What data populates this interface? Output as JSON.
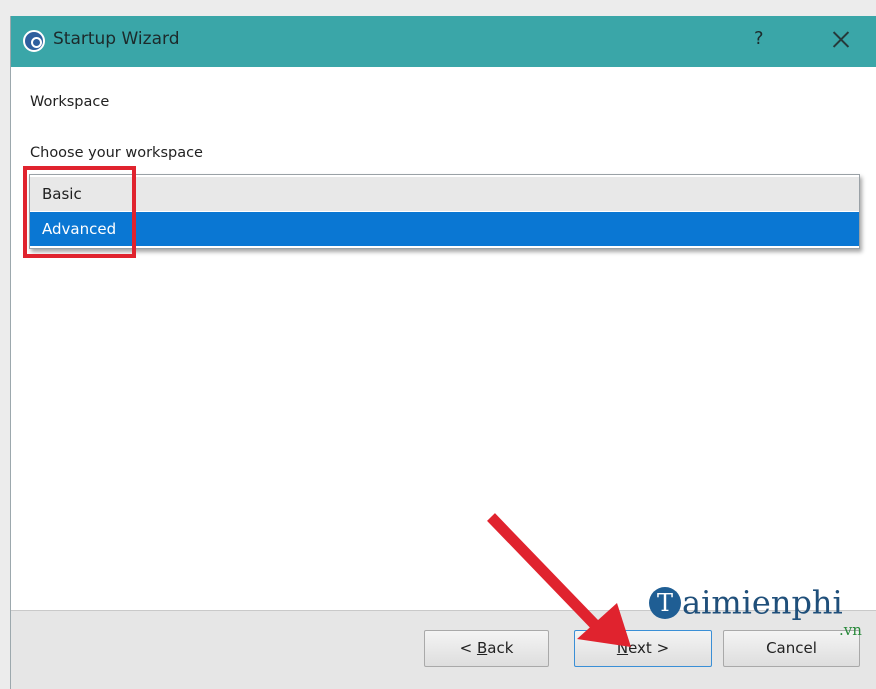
{
  "window": {
    "title": "Startup Wizard",
    "help_label": "?"
  },
  "page": {
    "section_title": "Workspace",
    "prompt": "Choose your workspace"
  },
  "dropdown": {
    "options": [
      {
        "label": "Basic",
        "selected": false
      },
      {
        "label": "Advanced",
        "selected": true
      }
    ]
  },
  "buttons": {
    "back": {
      "prefix": "< ",
      "mnemonic": "B",
      "rest": "ack"
    },
    "next": {
      "mnemonic": "N",
      "rest": "ext >"
    },
    "cancel": {
      "label": "Cancel"
    }
  },
  "watermark": {
    "badge": "T",
    "word": "aimienphi",
    "suffix": ".vn"
  },
  "colors": {
    "titlebar": "#3aa6a8",
    "selection": "#0a77d3",
    "annotation": "#e0232e"
  },
  "icons": [
    "app-icon",
    "help-icon",
    "close-icon",
    "arrow-annotation"
  ]
}
